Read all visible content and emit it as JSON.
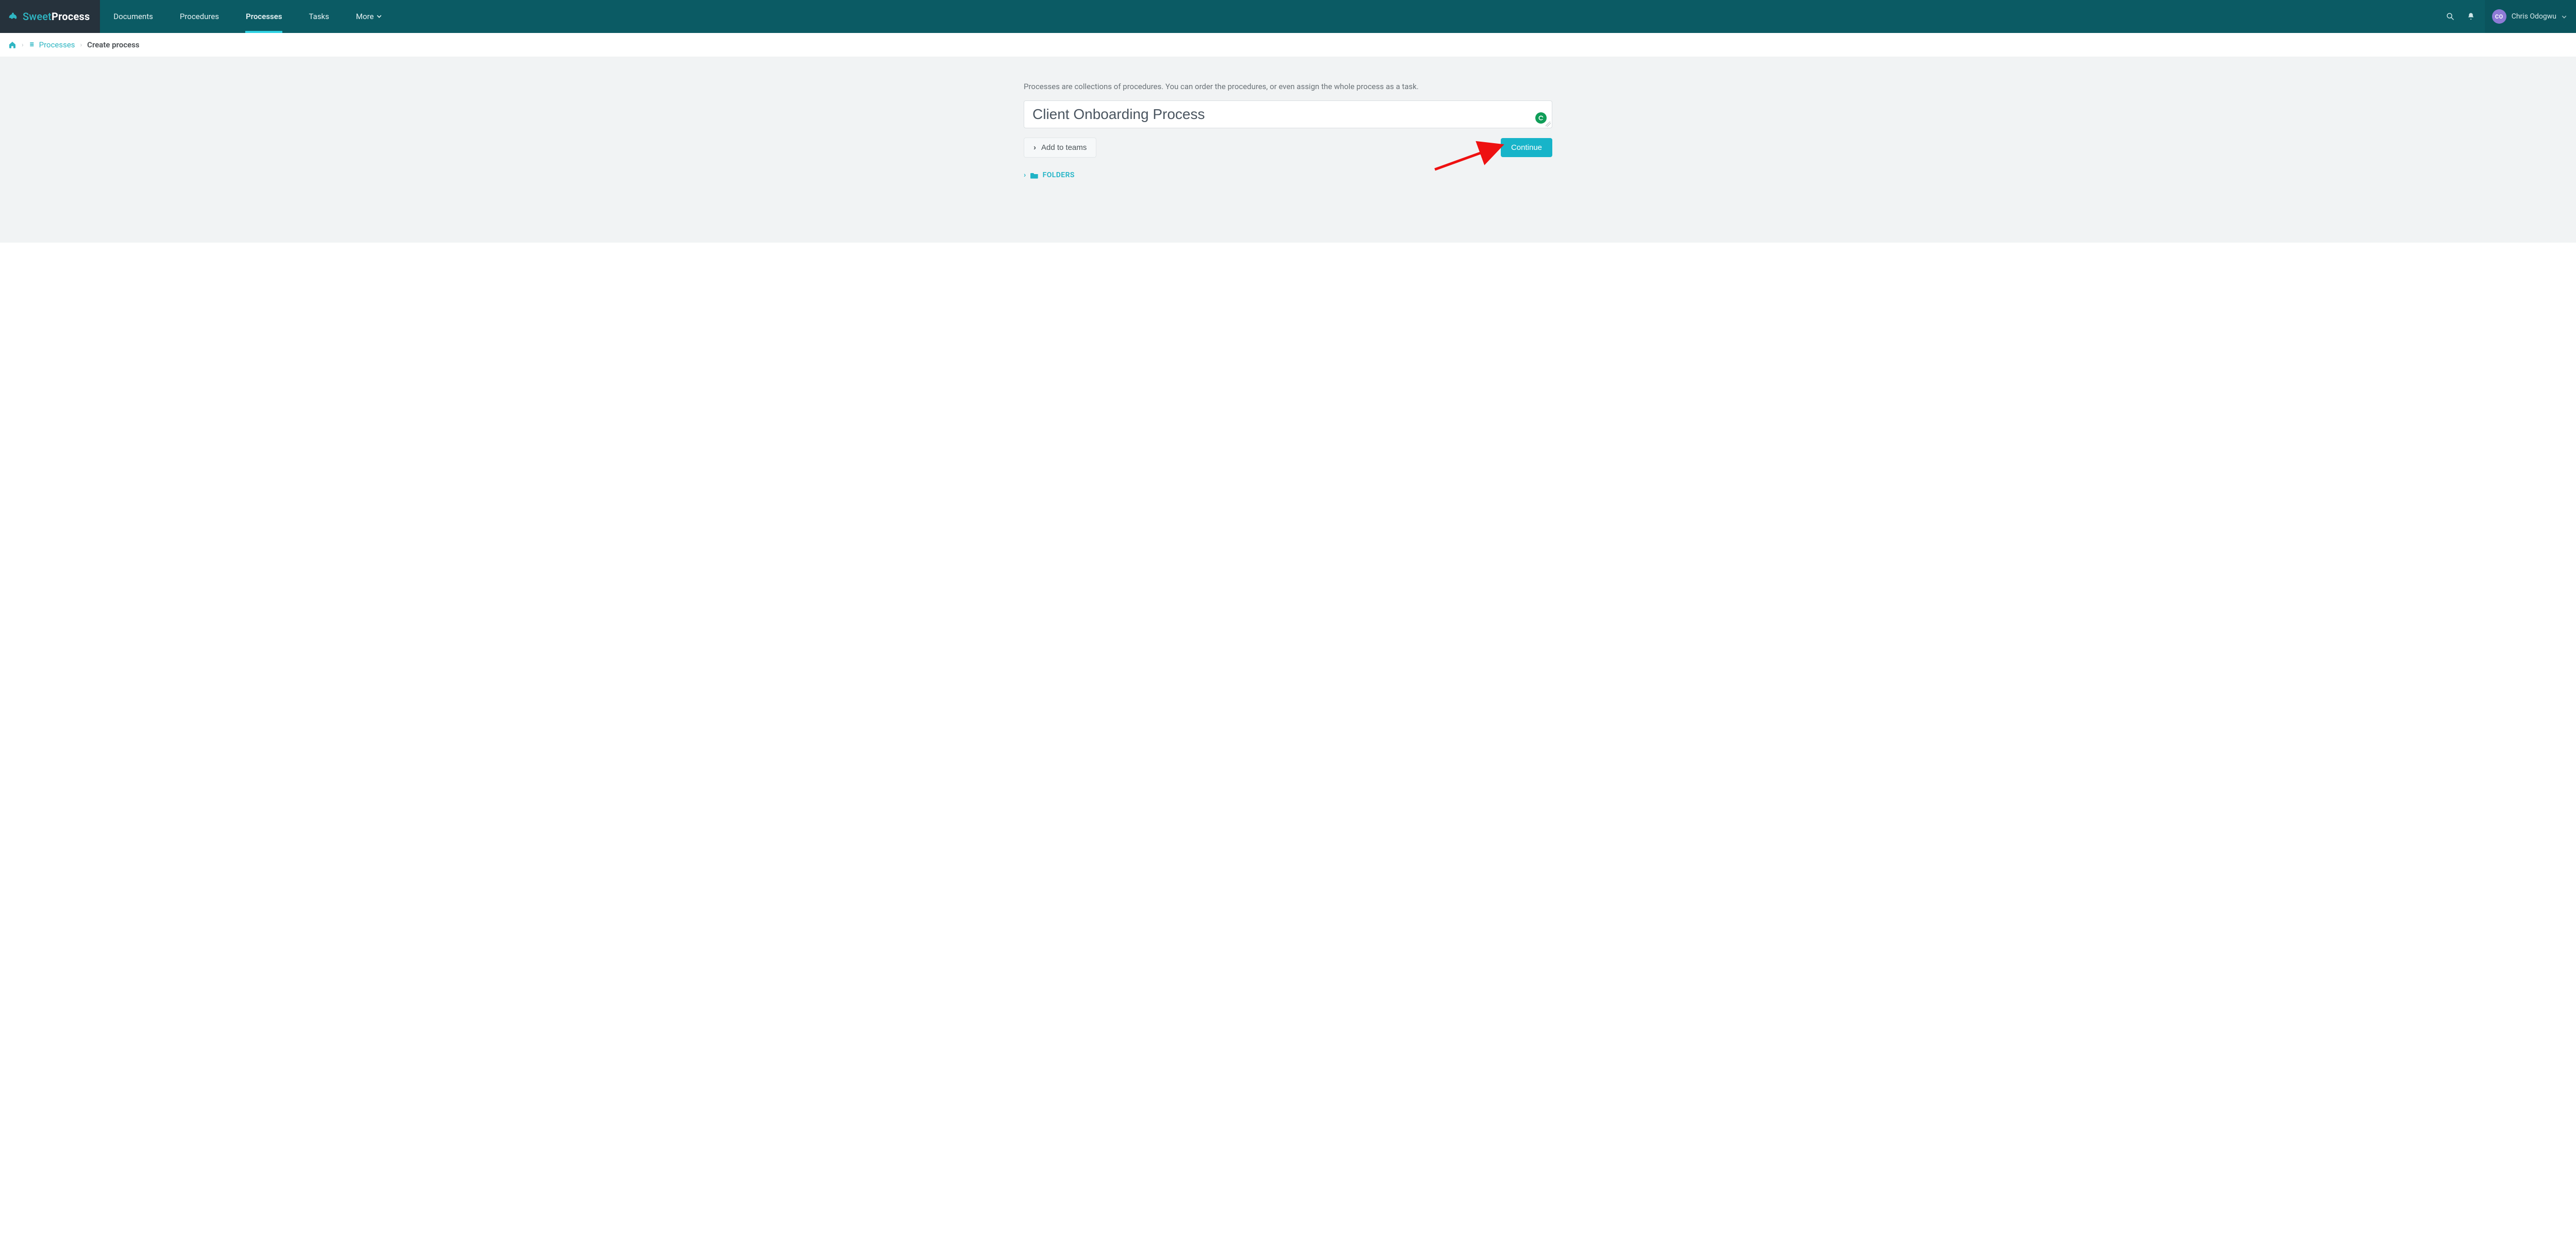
{
  "brand": {
    "sweet": "Sweet",
    "process": "Process"
  },
  "nav": {
    "items": [
      {
        "label": "Documents",
        "active": false
      },
      {
        "label": "Procedures",
        "active": false
      },
      {
        "label": "Processes",
        "active": true
      },
      {
        "label": "Tasks",
        "active": false
      },
      {
        "label": "More",
        "active": false,
        "has_caret": true
      }
    ]
  },
  "user": {
    "initials": "CO",
    "name": "Chris Odogwu"
  },
  "breadcrumb": {
    "link_label": "Processes",
    "current": "Create process"
  },
  "form": {
    "intro": "Processes are collections of procedures. You can order the procedures, or even assign the whole process as a task.",
    "title_value": "Client Onboarding Process",
    "add_teams_label": "Add to teams",
    "continue_label": "Continue",
    "folders_label": "FOLDERS"
  }
}
